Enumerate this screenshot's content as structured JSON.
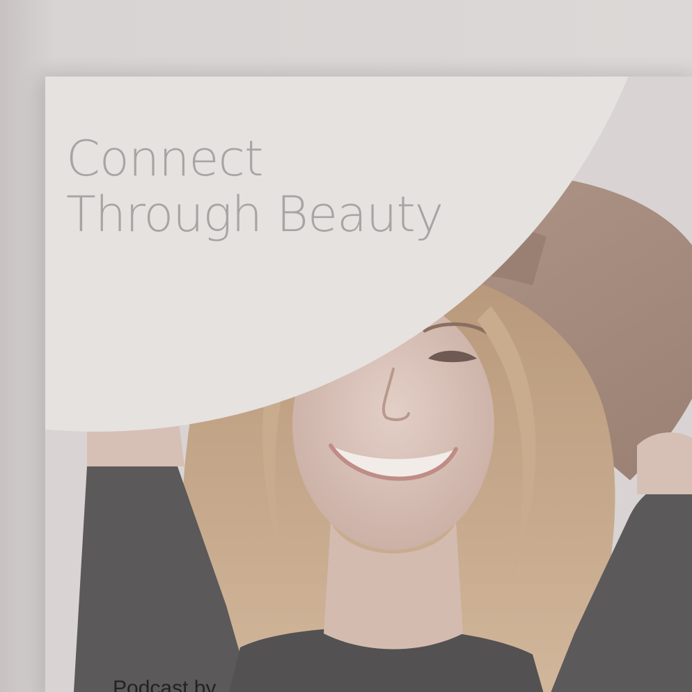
{
  "cover": {
    "title_line_1": "Connect",
    "title_line_2": "Through Beauty",
    "byline": "Podcast by"
  },
  "colors": {
    "background": "#d3cfce",
    "arc": "#e6e2e0",
    "title": "#a8a4a3",
    "hat": "#a88e80",
    "jacket": "#5a5859",
    "hair": "#c8a98b"
  }
}
